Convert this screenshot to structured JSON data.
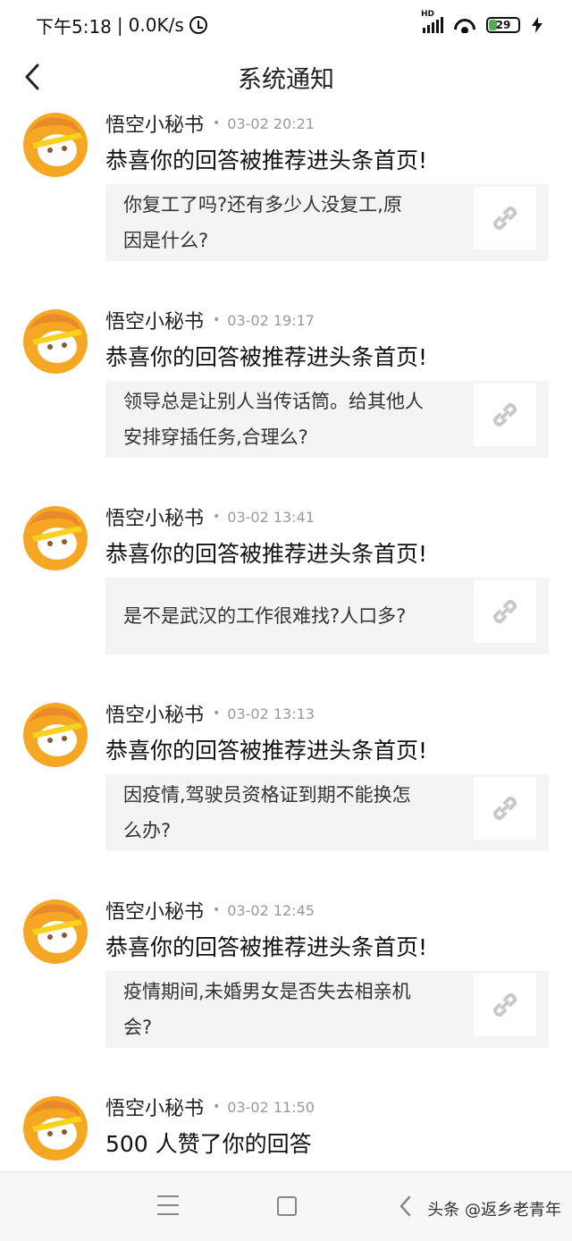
{
  "status_bar": {
    "time": "下午5:18",
    "separator": "|",
    "net_speed": "0.0K/s",
    "network_badge": "HD",
    "battery_level": "29",
    "battery_color": "#4caf50"
  },
  "header": {
    "title": "系统通知"
  },
  "notifications": [
    {
      "sender": "悟空小秘书",
      "dot": "•",
      "time": "03-02 20:21",
      "message": "恭喜你的回答被推荐进头条首页!",
      "question_lines": [
        "你复工了吗?还有多少人没复工,原",
        "因是什么?"
      ]
    },
    {
      "sender": "悟空小秘书",
      "dot": "•",
      "time": "03-02 19:17",
      "message": "恭喜你的回答被推荐进头条首页!",
      "question_lines": [
        "领导总是让别人当传话筒。给其他人",
        "安排穿插任务,合理么?"
      ]
    },
    {
      "sender": "悟空小秘书",
      "dot": "•",
      "time": "03-02 13:41",
      "message": "恭喜你的回答被推荐进头条首页!",
      "question_lines": [
        "是不是武汉的工作很难找?人口多?"
      ]
    },
    {
      "sender": "悟空小秘书",
      "dot": "•",
      "time": "03-02 13:13",
      "message": "恭喜你的回答被推荐进头条首页!",
      "question_lines": [
        "因疫情,驾驶员资格证到期不能换怎",
        "么办?"
      ]
    },
    {
      "sender": "悟空小秘书",
      "dot": "•",
      "time": "03-02 12:45",
      "message": "恭喜你的回答被推荐进头条首页!",
      "question_lines": [
        "疫情期间,未婚男女是否失去相亲机",
        "会?"
      ]
    },
    {
      "sender": "悟空小秘书",
      "dot": "•",
      "time": "03-02 11:50",
      "message": "500 人赞了你的回答"
    }
  ],
  "bottom_nav": {
    "watermark": "头条 @返乡老青年"
  },
  "colors": {
    "avatar": "#f5a623",
    "avatar_dark": "#e8892a",
    "headband": "#f7d21e"
  },
  "icons": [
    "back-arrow-icon",
    "alarm-icon",
    "signal-icon",
    "wifi-icon",
    "battery-icon",
    "charging-bolt-icon",
    "avatar-icon",
    "link-icon",
    "menu-icon",
    "home-icon",
    "nav-back-icon"
  ]
}
